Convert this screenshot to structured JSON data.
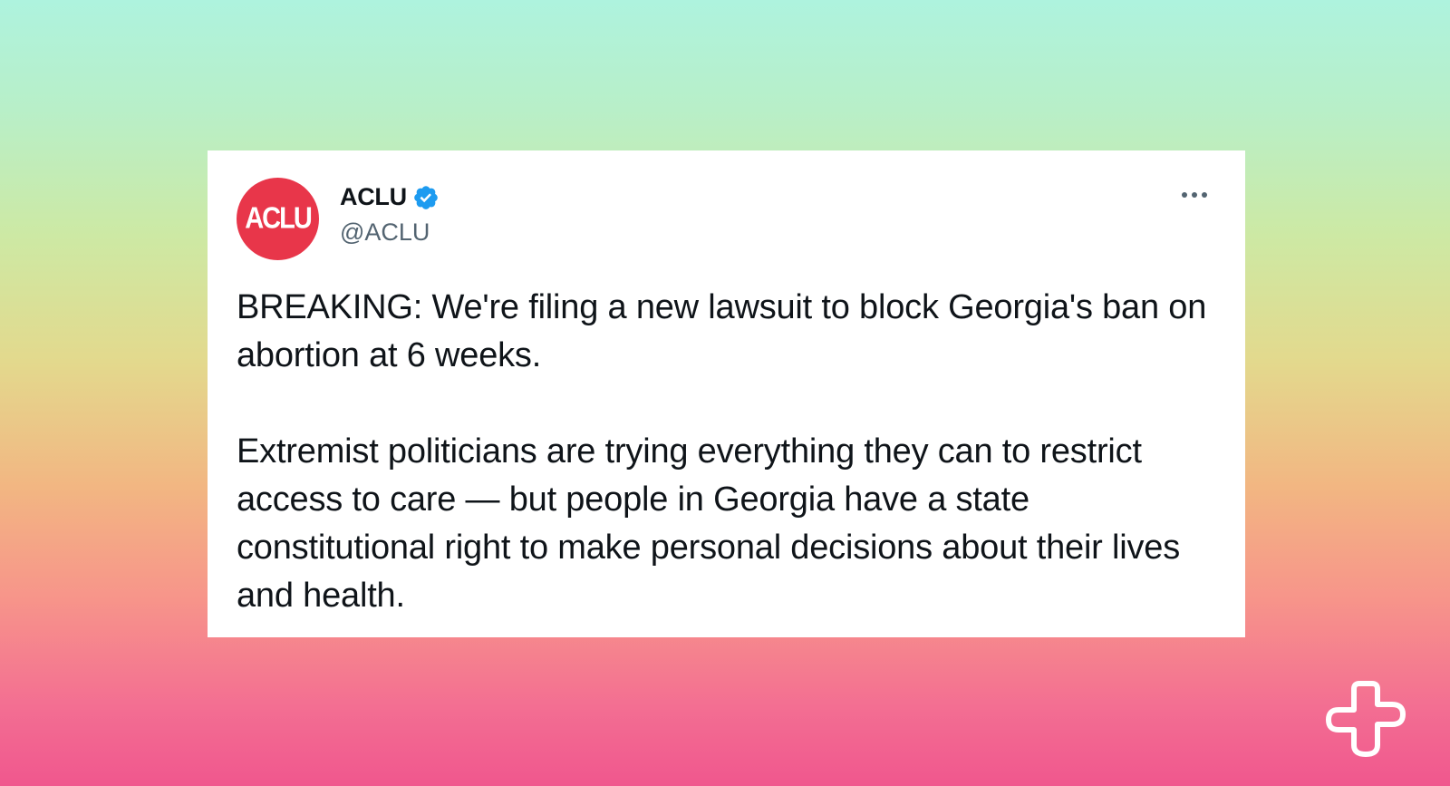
{
  "tweet": {
    "avatar_text": "ACLU",
    "display_name": "ACLU",
    "handle": "@ACLU",
    "verified": true,
    "paragraphs": [
      "BREAKING: We're filing a new lawsuit to block Georgia's ban on abortion at 6 weeks.",
      "Extremist politicians are trying everything they can to restrict access to care — but people in Georgia have a state constitutional right to make personal decisions about their lives and health."
    ]
  },
  "icons": {
    "verified": "verified-badge-icon",
    "more": "more-options-icon",
    "brand": "plus-logo-icon"
  },
  "colors": {
    "avatar": "#e8364a",
    "verified_badge": "#1d9bf0",
    "text_primary": "#0f1419",
    "text_secondary": "#536471",
    "gradient_top": "#aef3de",
    "gradient_bottom": "#f0578e"
  }
}
